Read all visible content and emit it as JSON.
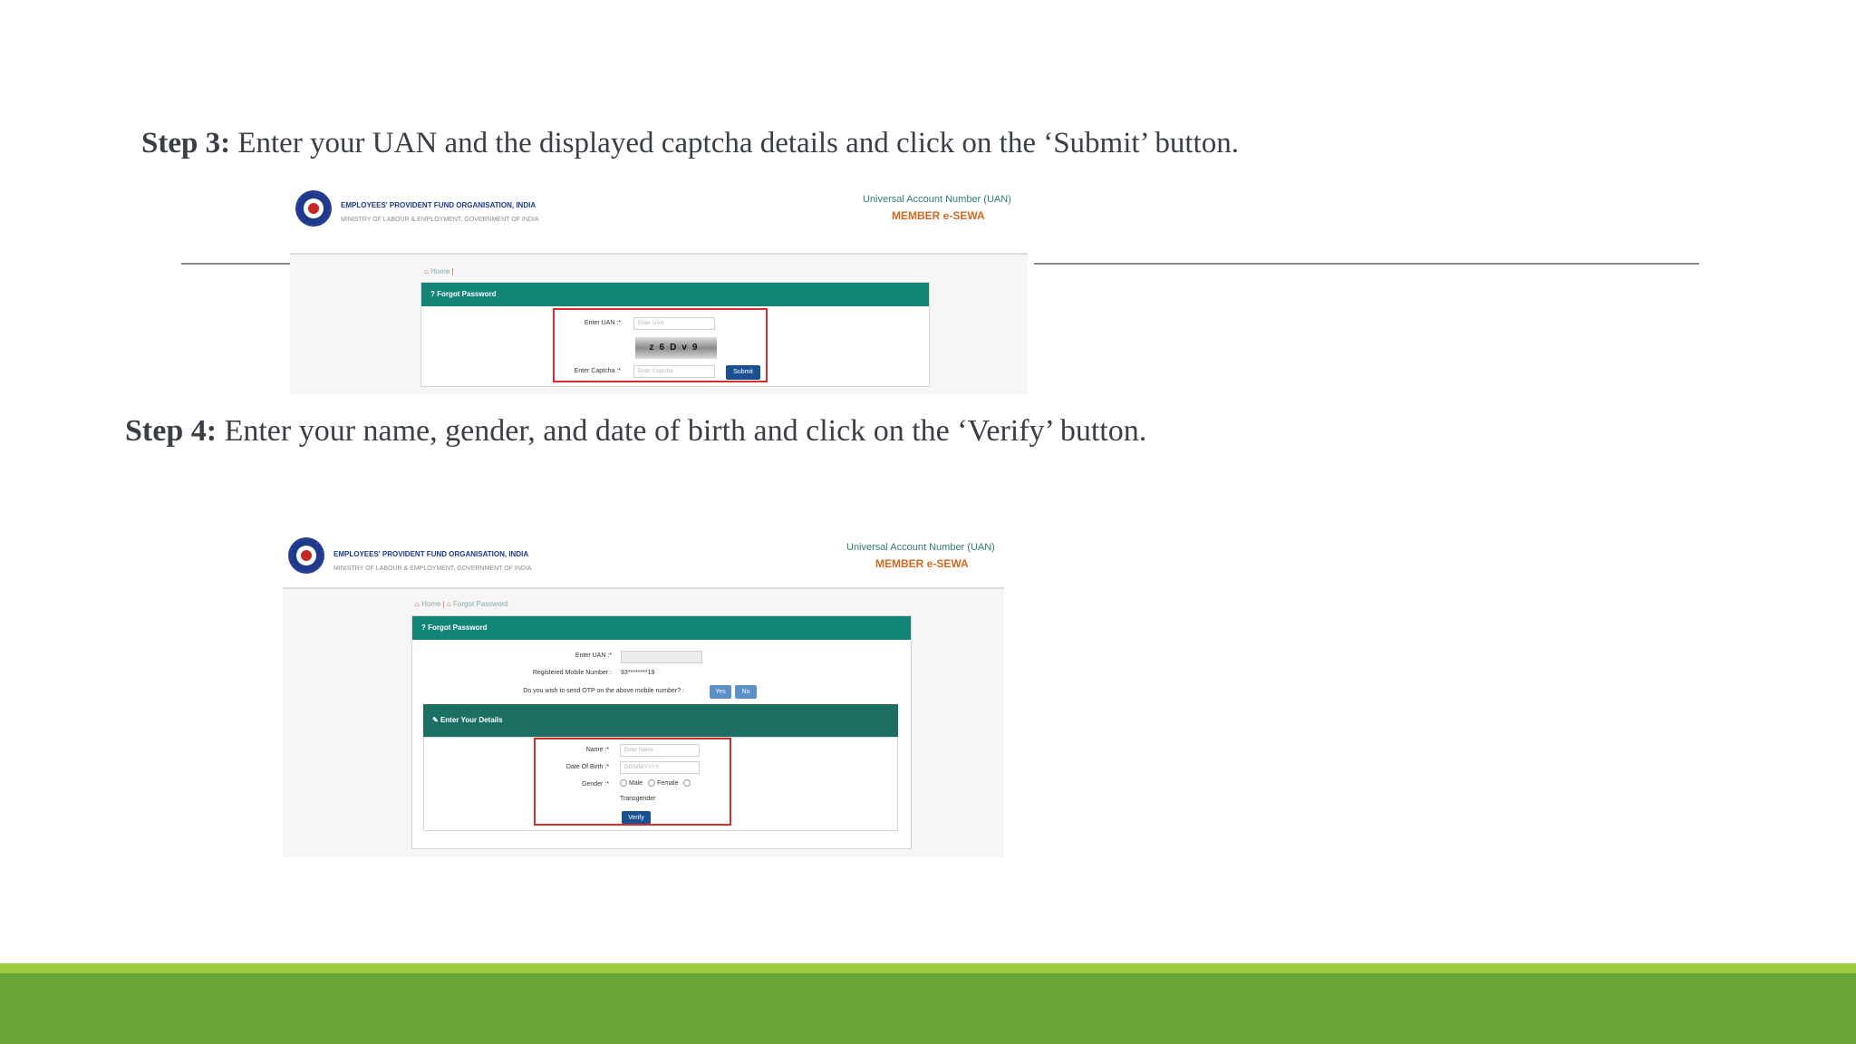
{
  "step3": {
    "bold": "Step 3:",
    "text": " Enter your UAN and the displayed captcha details and click on the ‘Submit’ button."
  },
  "step4": {
    "bold": "Step 4:",
    "text": " Enter your name, gender, and date of birth and click on the ‘Verify’ button."
  },
  "portal": {
    "org_name": "EMPLOYEES' PROVIDENT FUND ORGANISATION, INDIA",
    "ministry": "MINISTRY OF LABOUR & EMPLOYMENT, GOVERNMENT OF INDIA",
    "uan_title": "Universal Account Number (UAN)",
    "service": "MEMBER e-SEWA"
  },
  "shot1": {
    "breadcrumb_home": "Home",
    "breadcrumb_sep": "|",
    "panel_title": "? Forgot Password",
    "uan_label": "Enter UAN :*",
    "uan_placeholder": "Enter UAN",
    "captcha_text": "z6Dv9",
    "captcha_label": "Enter Captcha :*",
    "captcha_placeholder": "Enter Captcha",
    "submit_label": "Submit"
  },
  "shot2": {
    "breadcrumb_home": "Home",
    "breadcrumb_sep": "|",
    "breadcrumb_current": "Forgot Password",
    "panel_title": "? Forgot Password",
    "uan_label": "Enter UAN :*",
    "mobile_label": "Registered Mobile Number :",
    "mobile_value": "93********19",
    "otp_question": "Do you wish to send OTP on the above mobile number? :",
    "yes_label": "Yes",
    "no_label": "No",
    "details_title": "Enter Your Details",
    "name_label": "Name :*",
    "name_placeholder": "Enter Name",
    "dob_label": "Date Of Birth :*",
    "dob_placeholder": "DD/MM/YYYY",
    "gender_label": "Gender :*",
    "gender_male": "Male",
    "gender_female": "Female",
    "gender_transgender": "Transgender",
    "verify_label": "Verify"
  },
  "colors": {
    "teal": "#138576",
    "button_blue": "#1a4f91",
    "highlight_red": "#d32f2f",
    "band_light": "#9ccc3d",
    "band_dark": "#67a536"
  }
}
